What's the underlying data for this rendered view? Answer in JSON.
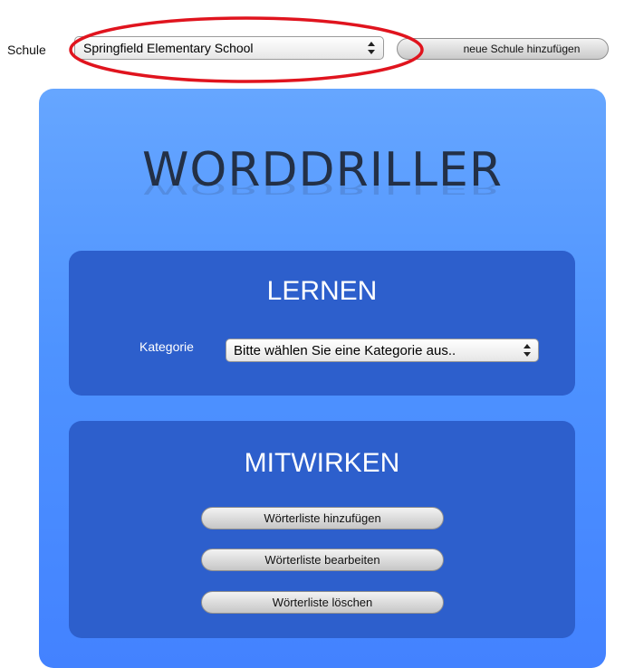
{
  "school_bar": {
    "label": "Schule",
    "selected_school": "Springfield Elementary School",
    "add_button_label": "neue Schule hinzufügen",
    "highlight_color": "#e0141e"
  },
  "main": {
    "title": "WORDDRILLER",
    "panel_color": "#4f93ff",
    "section_color": "#2d5fcc",
    "learn": {
      "heading": "LERNEN",
      "category_label": "Kategorie",
      "category_selected": "Bitte wählen Sie eine Kategorie aus.."
    },
    "contribute": {
      "heading": "MITWIRKEN",
      "buttons": [
        "Wörterliste hinzufügen",
        "Wörterliste bearbeiten",
        "Wörterliste löschen"
      ]
    }
  }
}
